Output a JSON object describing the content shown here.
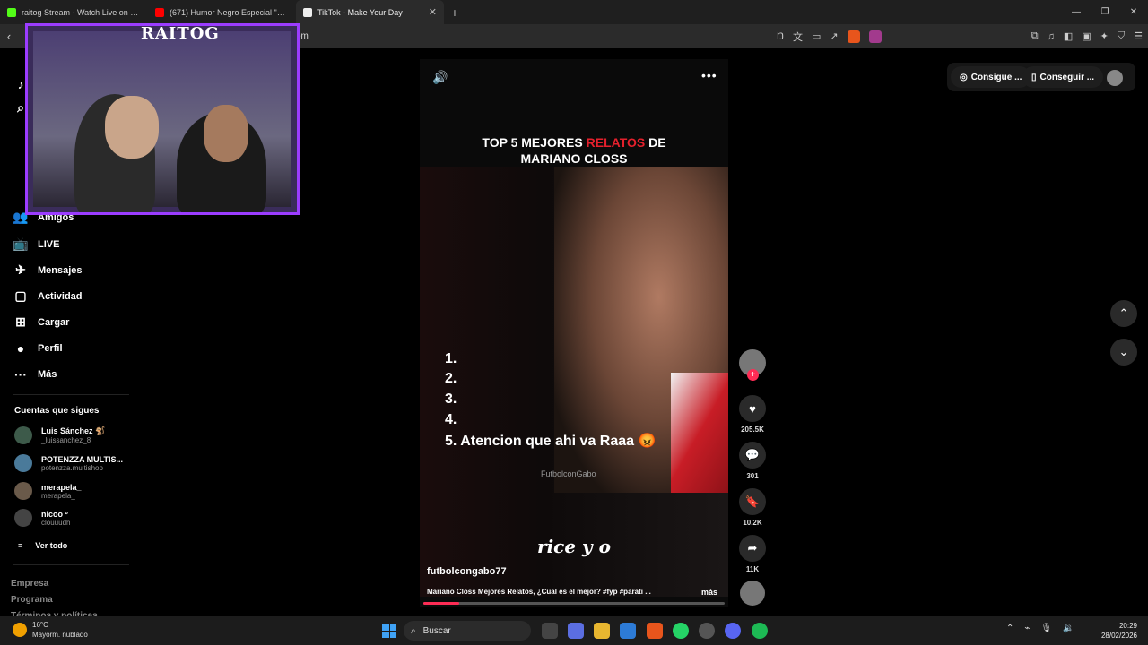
{
  "browser": {
    "tabs": [
      {
        "title": "raitog Stream - Watch Live on Kick",
        "icon": "kick-icon",
        "color": "#53fc18",
        "active": false
      },
      {
        "title": "(671) Humor Negro Especial \"Lo ME...",
        "icon": "youtube-icon",
        "color": "#ff0000",
        "active": false
      },
      {
        "title": "TikTok - Make Your Day",
        "icon": "tiktok-icon",
        "color": "#ffffff",
        "active": true
      }
    ],
    "url_fragment": "om"
  },
  "sidebar": {
    "items": [
      {
        "label": "Amigos",
        "icon": "friends-icon"
      },
      {
        "label": "LIVE",
        "icon": "live-icon"
      },
      {
        "label": "Mensajes",
        "icon": "messages-icon"
      },
      {
        "label": "Actividad",
        "icon": "activity-icon"
      },
      {
        "label": "Cargar",
        "icon": "upload-icon"
      },
      {
        "label": "Perfil",
        "icon": "profile-icon"
      },
      {
        "label": "Más",
        "icon": "more-icon"
      }
    ],
    "following_title": "Cuentas que sigues",
    "accounts": [
      {
        "name": "Luis Sánchez 🐒",
        "handle": "_luissanchez_8"
      },
      {
        "name": "POTENZZA MULTIS...",
        "handle": "potenzza.multishop"
      },
      {
        "name": "merapela_",
        "handle": "merapela_"
      },
      {
        "name": "nicoo º",
        "handle": "clouuudh"
      }
    ],
    "see_all": "Ver todo",
    "footer": [
      "Empresa",
      "Programa",
      "Términos y políticas"
    ]
  },
  "overlay": {
    "streamer_logo": "RAITOG"
  },
  "video": {
    "title_line1_pre": "TOP 5 MEJORES ",
    "title_line1_red": "RELATOS",
    "title_line1_post": " DE",
    "title_line2": "MARIANO CLOSS",
    "ranks": [
      "1.",
      "2.",
      "3.",
      "4.",
      "5. Atencion que ahi va Raaa 😡"
    ],
    "watermark": "FutbolconGabo",
    "subtitle": "rice y o",
    "author": "futbolcongabo77",
    "caption": "Mariano Closs Mejores Relatos, ¿Cual es el mejor? #fyp #parati ...",
    "more": "más",
    "progress": 0.12,
    "accent": "#fe2c55"
  },
  "actions": {
    "likes": "205.5K",
    "comments": "301",
    "saves": "10.2K",
    "shares": "11K"
  },
  "topright": {
    "coins_label": "Consigue ...",
    "app_label": "Conseguir ..."
  },
  "taskbar": {
    "temp": "16°C",
    "weather": "Mayorm. nublado",
    "search_placeholder": "Buscar",
    "time": "20:29",
    "date": "28/02/2026"
  }
}
